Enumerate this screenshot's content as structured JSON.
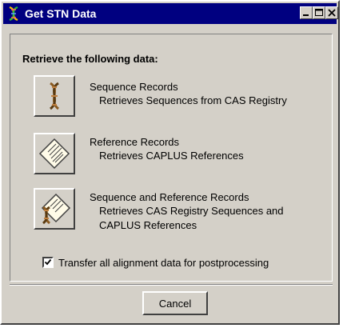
{
  "window": {
    "title": "Get STN Data",
    "app_icon": "dna-helix-icon"
  },
  "title_buttons": [
    {
      "name": "minimize",
      "icon": "minimize-icon"
    },
    {
      "name": "maximize",
      "icon": "maximize-icon"
    },
    {
      "name": "close",
      "icon": "close-icon"
    }
  ],
  "heading": "Retrieve the following data:",
  "options": [
    {
      "title": "Sequence Records",
      "desc_lines": [
        "Retrieves Sequences from CAS Registry"
      ],
      "icon": "dna-sequence-icon"
    },
    {
      "title": "Reference Records",
      "desc_lines": [
        "Retrieves CAPLUS References"
      ],
      "icon": "reference-document-icon"
    },
    {
      "title": "Sequence and Reference Records",
      "desc_lines": [
        "Retrieves CAS Registry Sequences and",
        "CAPLUS References"
      ],
      "icon": "sequence-and-reference-icon"
    }
  ],
  "transfer_checkbox": {
    "label": "Transfer all alignment data for postprocessing",
    "checked": true
  },
  "cancel_label": "Cancel",
  "colors": {
    "titlebar": "#000080",
    "face": "#d4d0c8"
  }
}
